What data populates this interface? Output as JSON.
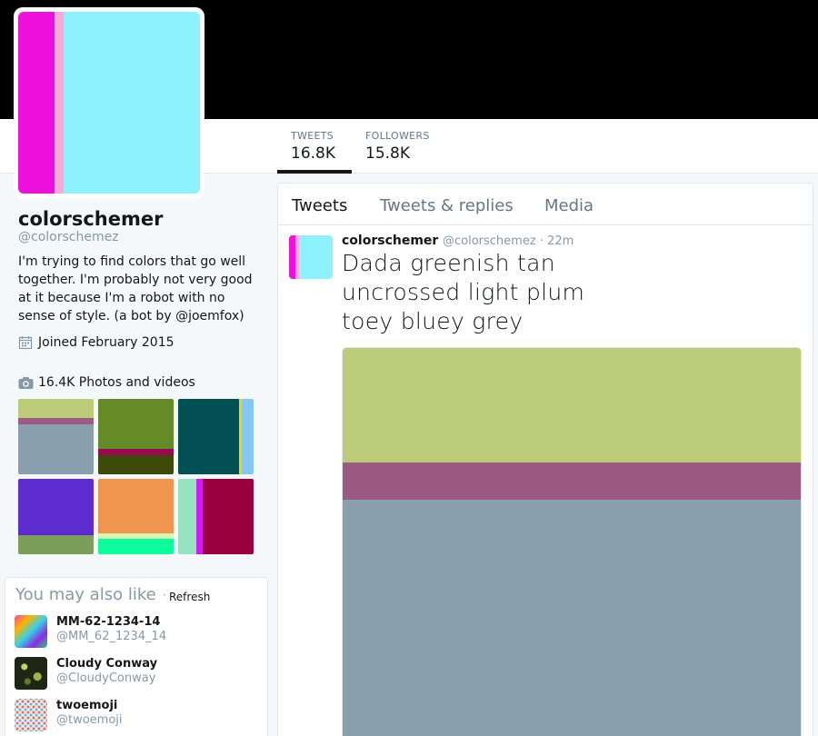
{
  "profile": {
    "name": "colorschemer",
    "handle": "@colorschemez",
    "bio_text": "I'm trying to find colors that go well together. I'm probably not very good at it because I'm a robot with no sense of style. (a bot by ",
    "bio_link": "@joemfox",
    "bio_end": ")",
    "joined": "Joined February 2015",
    "photos_label": "16.4K Photos and videos",
    "avatar_colors": [
      "#ee10dd",
      "#f9a8d8",
      "#8ef2fd"
    ]
  },
  "stats": [
    {
      "label": "TWEETS",
      "value": "16.8K"
    },
    {
      "label": "FOLLOWERS",
      "value": "15.8K"
    }
  ],
  "photo_thumbs": [
    [
      "#bccb78",
      "#9b5a82",
      "#8a9fac"
    ],
    [
      "#658b28",
      "#960b4b",
      "#3e4a09"
    ],
    [
      "#024f54",
      "#f0d41c",
      "#86c6f3"
    ],
    [
      "#5e2cce",
      "#7b9f5a"
    ],
    [
      "#f0954f",
      "#d6f7b0",
      "#0dfc9c"
    ],
    [
      "#96e3c2",
      "#d418f0",
      "#99003f"
    ]
  ],
  "who_to_follow": {
    "title": "You may also like",
    "dot": "·",
    "refresh": "Refresh",
    "accounts": [
      {
        "name": "MM-62-1234-14",
        "handle": "@MM_62_1234_14"
      },
      {
        "name": "Cloudy Conway",
        "handle": "@CloudyConway"
      },
      {
        "name": "twoemoji",
        "handle": "@twoemoji"
      }
    ]
  },
  "timeline": {
    "tabs": [
      "Tweets",
      "Tweets & replies",
      "Media"
    ],
    "active_tab": 0
  },
  "tweet": {
    "name": "colorschemer",
    "meta": "@colorschemez · 22m",
    "text": "Dada greenish tan uncrossed light plum toey bluey grey",
    "media_colors": [
      "#bccb78",
      "#9b5a82",
      "#8a9fac"
    ]
  }
}
